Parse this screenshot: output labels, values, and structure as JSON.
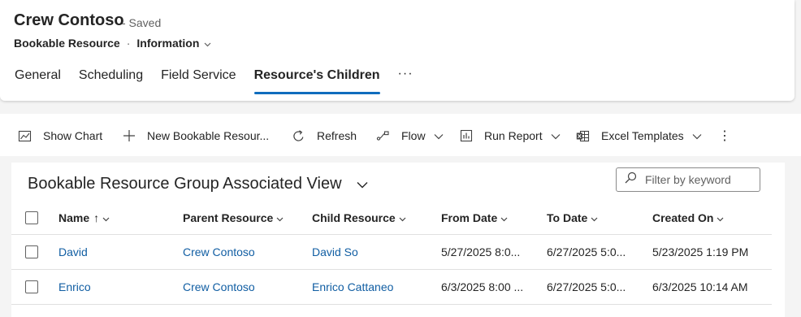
{
  "record": {
    "title": "Crew Contoso",
    "saved": "- Saved",
    "entity": "Bookable Resource",
    "separator": "·",
    "form": "Information"
  },
  "tabs": [
    {
      "label": "General",
      "active": false
    },
    {
      "label": "Scheduling",
      "active": false
    },
    {
      "label": "Field Service",
      "active": false
    },
    {
      "label": "Resource's Children",
      "active": true
    }
  ],
  "tabs_more": "···",
  "commands": {
    "show_chart": "Show Chart",
    "new_record": "New Bookable Resour...",
    "refresh": "Refresh",
    "flow": "Flow",
    "run_report": "Run Report",
    "excel_templates": "Excel Templates",
    "more": "⋮"
  },
  "view": {
    "title": "Bookable Resource Group Associated View",
    "filter_placeholder": "Filter by keyword"
  },
  "columns": [
    {
      "label": "Name",
      "sort": "↑"
    },
    {
      "label": "Parent Resource",
      "sort": ""
    },
    {
      "label": "Child Resource",
      "sort": ""
    },
    {
      "label": "From Date",
      "sort": ""
    },
    {
      "label": "To Date",
      "sort": ""
    },
    {
      "label": "Created On",
      "sort": ""
    }
  ],
  "rows": [
    {
      "name": "David",
      "parent": "Crew Contoso",
      "child": "David So",
      "from": "5/27/2025 8:0...",
      "to": "6/27/2025 5:0...",
      "created": "5/23/2025 1:19 PM"
    },
    {
      "name": "Enrico",
      "parent": "Crew Contoso",
      "child": "Enrico Cattaneo",
      "from": "6/3/2025 8:00 ...",
      "to": "6/27/2025 5:0...",
      "created": "6/3/2025 10:14 AM"
    }
  ],
  "colors": {
    "accent": "#0f6cbd",
    "link": "#115ea3",
    "text": "#242424",
    "muted": "#616161"
  }
}
